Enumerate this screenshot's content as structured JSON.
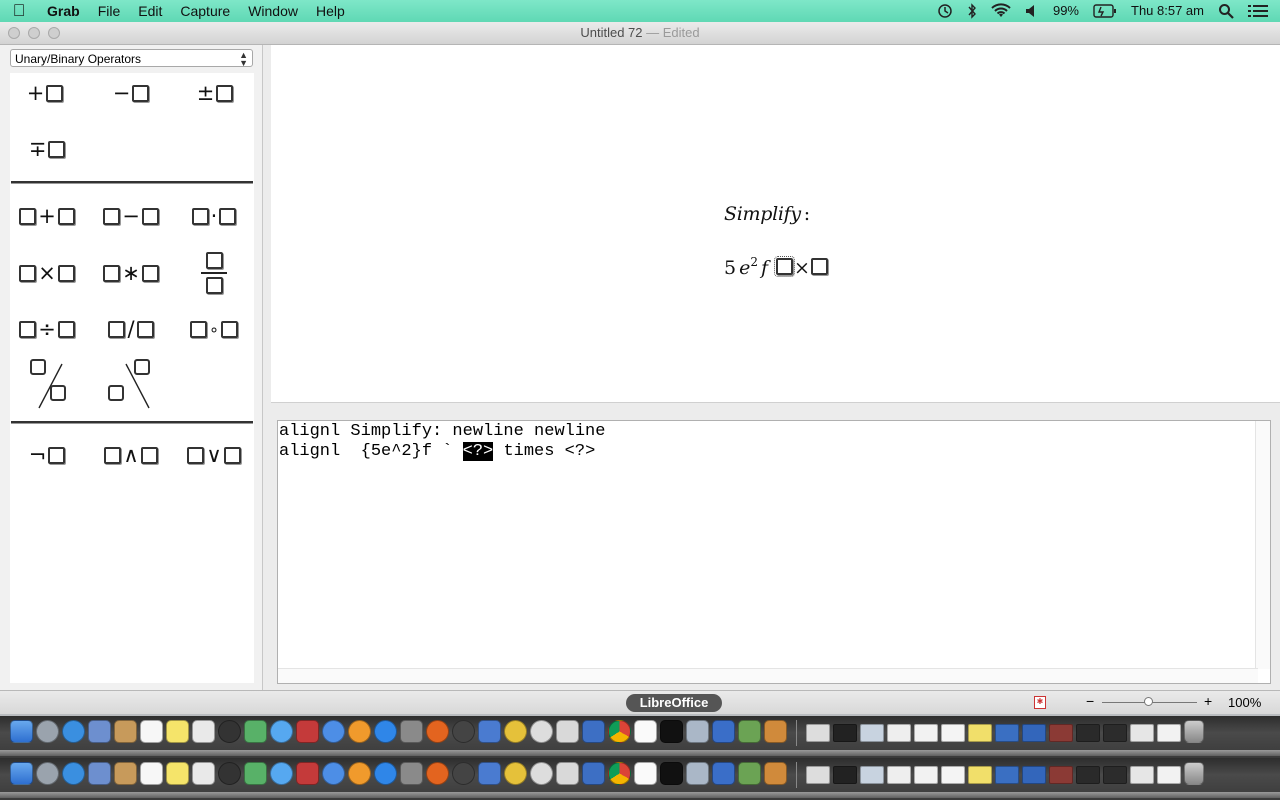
{
  "menubar": {
    "items": [
      "Grab",
      "File",
      "Edit",
      "Capture",
      "Window",
      "Help"
    ],
    "battery": "99%",
    "clock": "Thu 8:57 am",
    "icons": [
      "apple-icon",
      "time-machine-icon",
      "bluetooth-icon",
      "wifi-icon",
      "volume-icon",
      "battery-icon",
      "spotlight-icon",
      "notification-center-icon"
    ]
  },
  "window": {
    "title": "Untitled 72",
    "edited": "— Edited"
  },
  "elements": {
    "category": "Unary/Binary Operators",
    "groups": [
      [
        "+",
        "−",
        "±",
        "∓"
      ],
      [
        "+",
        "−",
        "·",
        "×",
        "∗",
        "frac",
        "÷",
        "/",
        "∘",
        "wideslash",
        "widebslash"
      ],
      [
        "¬",
        "∧",
        "∨"
      ]
    ]
  },
  "formula": {
    "line1": "Simplify",
    "line1_colon": ":",
    "coef": "5",
    "var_e": "e",
    "exp": "2",
    "var_f": "f",
    "times": "×"
  },
  "command": {
    "line1": "alignl Simplify: newline newline",
    "line2_pre": "alignl  {5e^2}f ` ",
    "line2_sel": "<?>",
    "line2_post": " times <?>"
  },
  "status": {
    "app": "LibreOffice",
    "zoom": "100%",
    "zoom_minus": "−",
    "zoom_plus": "+"
  },
  "colors": {
    "menubar": "#6fe0be",
    "selection": "#000000"
  }
}
